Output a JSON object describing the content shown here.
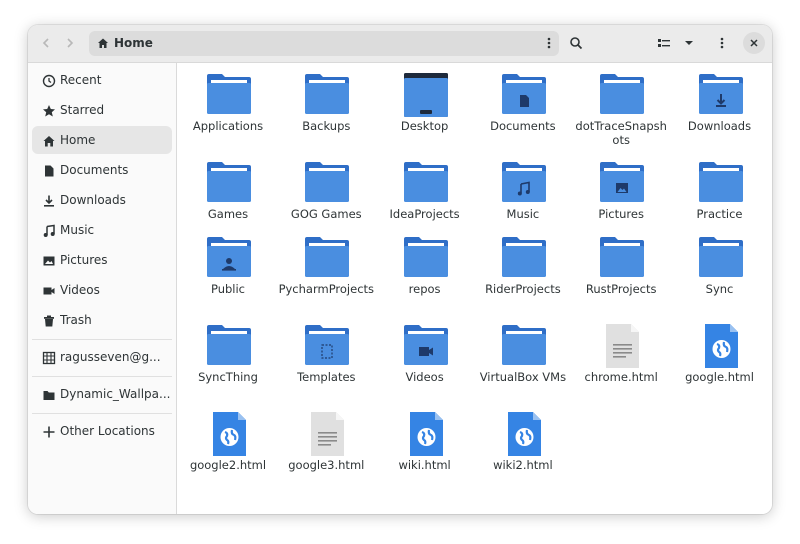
{
  "header": {
    "location_title": "Home"
  },
  "sidebar": {
    "places": [
      {
        "label": "Recent",
        "icon": "clock-icon"
      },
      {
        "label": "Starred",
        "icon": "star-icon"
      },
      {
        "label": "Home",
        "icon": "home-icon"
      },
      {
        "label": "Documents",
        "icon": "document-icon"
      },
      {
        "label": "Downloads",
        "icon": "download-icon"
      },
      {
        "label": "Music",
        "icon": "music-icon"
      },
      {
        "label": "Pictures",
        "icon": "picture-icon"
      },
      {
        "label": "Videos",
        "icon": "video-icon"
      },
      {
        "label": "Trash",
        "icon": "trash-icon"
      }
    ],
    "network": [
      {
        "label": "ragusseven@g...",
        "icon": "network-drive-icon"
      }
    ],
    "bookmarks": [
      {
        "label": "Dynamic_Wallpa...",
        "icon": "folder-icon"
      }
    ],
    "other": [
      {
        "label": "Other Locations",
        "icon": "plus-icon"
      }
    ]
  },
  "files": [
    {
      "name": "Applications",
      "kind": "folder",
      "emblem": "none"
    },
    {
      "name": "Backups",
      "kind": "folder",
      "emblem": "none"
    },
    {
      "name": "Desktop",
      "kind": "folder",
      "emblem": "desktop"
    },
    {
      "name": "Documents",
      "kind": "folder",
      "emblem": "document"
    },
    {
      "name": "dotTraceSnapshots",
      "kind": "folder",
      "emblem": "none"
    },
    {
      "name": "Downloads",
      "kind": "folder",
      "emblem": "download"
    },
    {
      "name": "Games",
      "kind": "folder",
      "emblem": "none"
    },
    {
      "name": "GOG Games",
      "kind": "folder",
      "emblem": "none"
    },
    {
      "name": "IdeaProjects",
      "kind": "folder",
      "emblem": "none"
    },
    {
      "name": "Music",
      "kind": "folder",
      "emblem": "music"
    },
    {
      "name": "Pictures",
      "kind": "folder",
      "emblem": "picture"
    },
    {
      "name": "Practice",
      "kind": "folder",
      "emblem": "none"
    },
    {
      "name": "Public",
      "kind": "folder",
      "emblem": "public"
    },
    {
      "name": "PycharmProjects",
      "kind": "folder",
      "emblem": "none"
    },
    {
      "name": "repos",
      "kind": "folder",
      "emblem": "none"
    },
    {
      "name": "RiderProjects",
      "kind": "folder",
      "emblem": "none"
    },
    {
      "name": "RustProjects",
      "kind": "folder",
      "emblem": "none"
    },
    {
      "name": "Sync",
      "kind": "folder",
      "emblem": "none"
    },
    {
      "name": "SyncThing",
      "kind": "folder",
      "emblem": "none"
    },
    {
      "name": "Templates",
      "kind": "folder",
      "emblem": "template"
    },
    {
      "name": "Videos",
      "kind": "folder",
      "emblem": "video"
    },
    {
      "name": "VirtualBox VMs",
      "kind": "folder",
      "emblem": "none"
    },
    {
      "name": "chrome.html",
      "kind": "text",
      "emblem": "none"
    },
    {
      "name": "google.html",
      "kind": "html",
      "emblem": "none"
    },
    {
      "name": "google2.html",
      "kind": "html",
      "emblem": "none"
    },
    {
      "name": "google3.html",
      "kind": "text",
      "emblem": "none"
    },
    {
      "name": "wiki.html",
      "kind": "html",
      "emblem": "none"
    },
    {
      "name": "wiki2.html",
      "kind": "html",
      "emblem": "none"
    }
  ],
  "colors": {
    "folder_back": "#2f6ec7",
    "folder_front": "#4a8ee0",
    "folder_paper": "#ffffff",
    "emblem": "#1e3a6a",
    "html_page": "#3584e4",
    "text_page": "#e0e0e0"
  }
}
